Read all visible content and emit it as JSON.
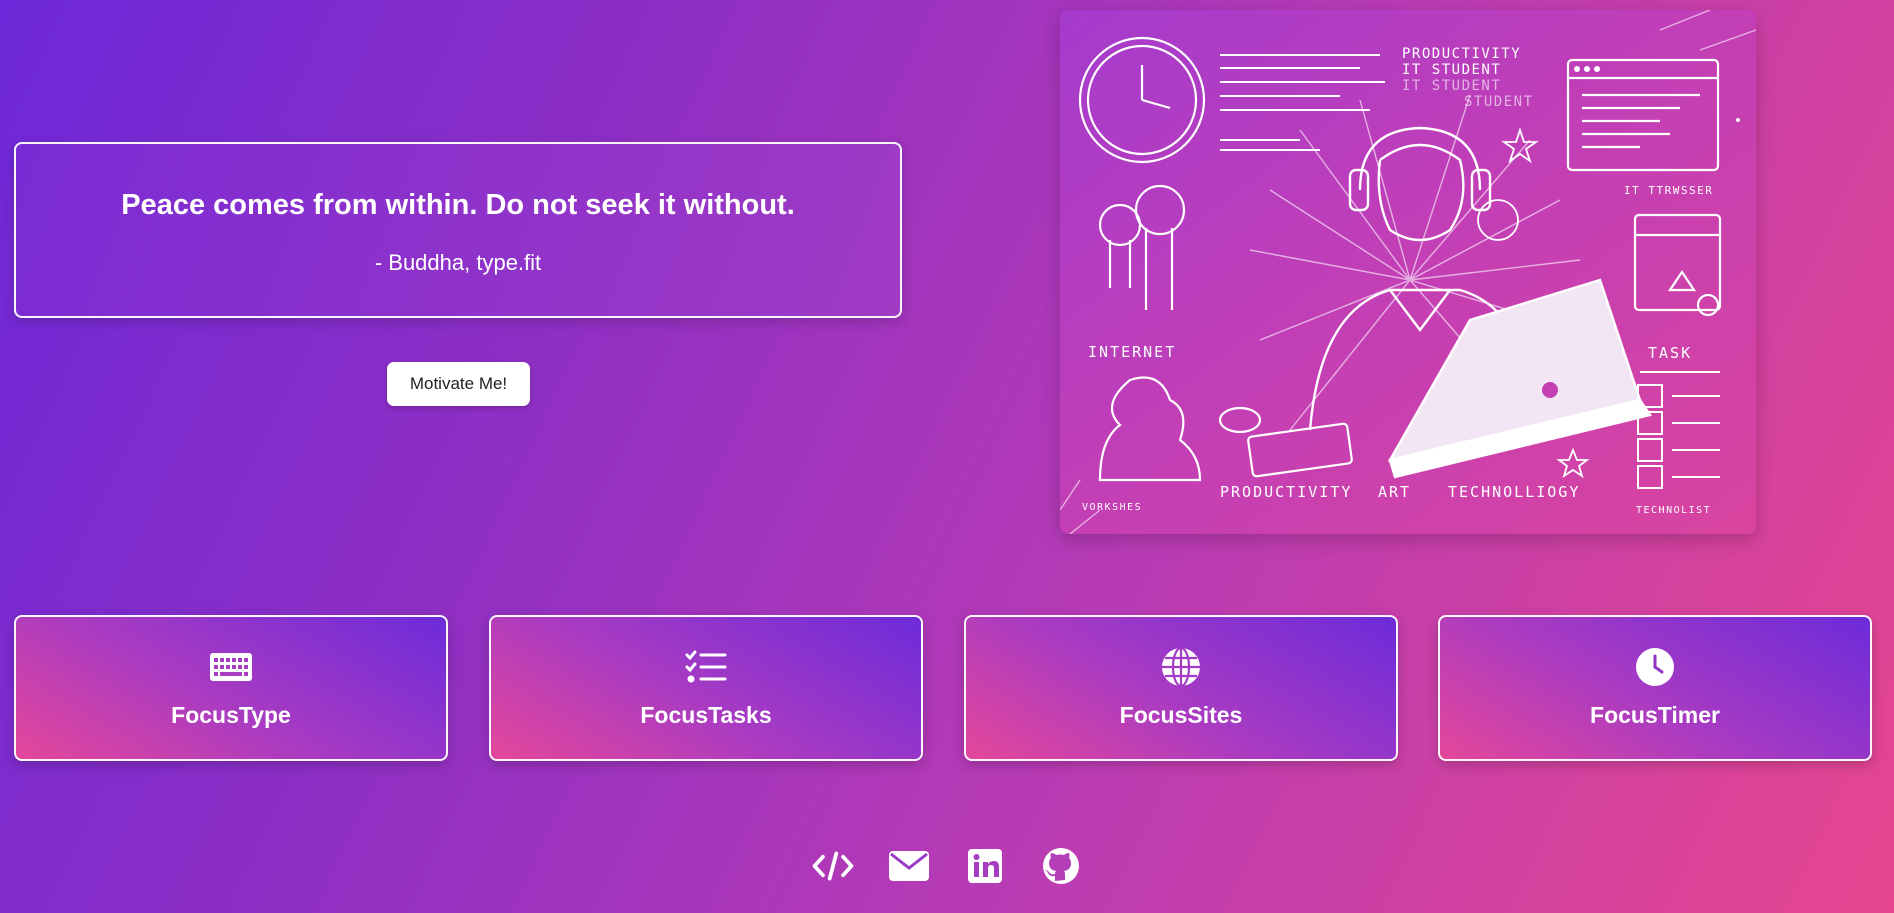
{
  "quote": {
    "text": "Peace comes from within. Do not seek it without.",
    "author": "- Buddha, type.fit"
  },
  "motivate_button": {
    "label": "Motivate Me!"
  },
  "illustration": {
    "labels": {
      "productivity_top": "PRODUCTIVITY",
      "it_student": "IT STUDENT",
      "it_student_2": "IT STUDENT",
      "student": "STUDENT",
      "it_browser": "IT TTRWSSER",
      "internet": "INTERNET",
      "task": "TASK",
      "productivity_bottom": "PRODUCTIVITY",
      "art": "ART",
      "technology": "TECHNOLLIOGY",
      "workshops": "VORKSHES",
      "technolist": "TECHNOLIST"
    }
  },
  "cards": [
    {
      "label": "FocusType",
      "icon": "keyboard-icon"
    },
    {
      "label": "FocusTasks",
      "icon": "task-list-icon"
    },
    {
      "label": "FocusSites",
      "icon": "globe-icon"
    },
    {
      "label": "FocusTimer",
      "icon": "clock-icon"
    }
  ],
  "footer": {
    "links": [
      {
        "icon": "code-icon"
      },
      {
        "icon": "envelope-icon"
      },
      {
        "icon": "linkedin-icon"
      },
      {
        "icon": "github-icon"
      }
    ]
  },
  "colors": {
    "gradient_start": "#6d28d9",
    "gradient_end": "#e6468f",
    "text": "#ffffff",
    "button_bg": "#ffffff",
    "button_text": "#222222"
  }
}
